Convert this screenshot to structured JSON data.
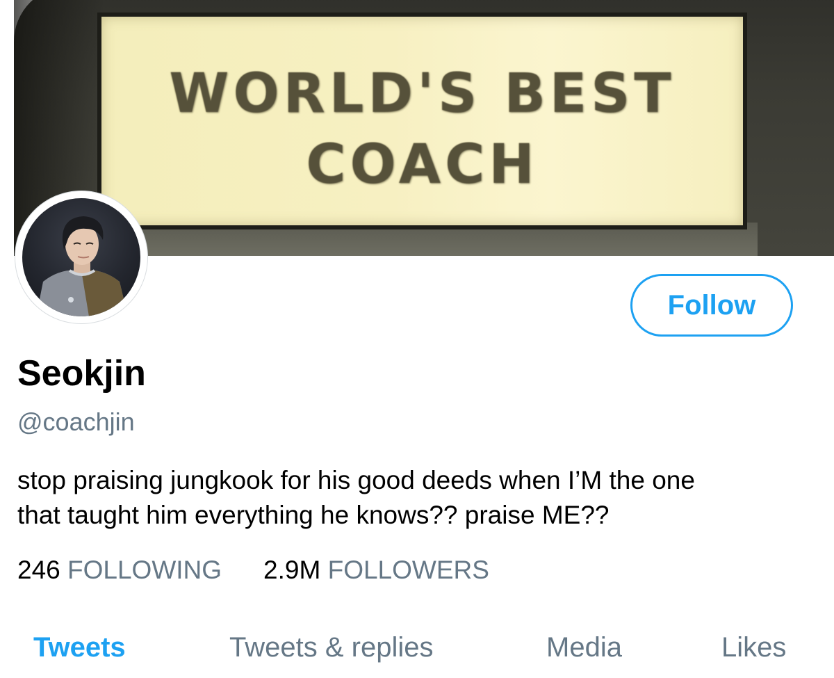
{
  "banner": {
    "line1": "WORLD'S  BEST",
    "line2": "COACH"
  },
  "profile": {
    "display_name": "Seokjin",
    "handle": "@coachjin",
    "bio_line1": "stop praising jungkook for his good deeds when I’M the one",
    "bio_line2": "that taught him everything he knows?? praise ME??",
    "follow_label": "Follow"
  },
  "stats": {
    "following_count": "246",
    "following_label": "FOLLOWING",
    "followers_count": "2.9M",
    "followers_label": "FOLLOWERS"
  },
  "tabs": [
    {
      "label": "Tweets",
      "active": true
    },
    {
      "label": "Tweets & replies",
      "active": false
    },
    {
      "label": "Media",
      "active": false
    },
    {
      "label": "Likes",
      "active": false
    }
  ],
  "colors": {
    "accent": "#1da1f2",
    "secondary_text": "#657786",
    "primary_text": "#000000"
  },
  "icons": {
    "avatar": "profile-photo"
  }
}
